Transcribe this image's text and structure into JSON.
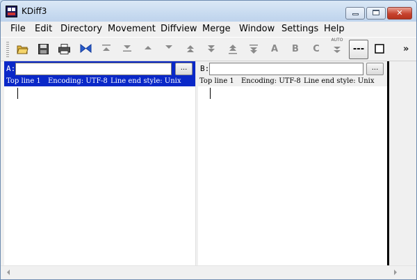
{
  "window": {
    "title": "KDiff3"
  },
  "menu": [
    "File",
    "Edit",
    "Directory",
    "Movement",
    "Diffview",
    "Merge",
    "Window",
    "Settings",
    "Help"
  ],
  "toolbar": {
    "icons": [
      "open-folder-icon",
      "save-icon",
      "print-icon",
      "merge-bowtie-icon",
      "go-top-icon",
      "go-bottom-icon",
      "go-prev-delta-icon",
      "go-next-delta-icon",
      "go-prev-conflict-icon",
      "go-next-conflict-icon",
      "go-prev-unsolved-icon",
      "go-next-unsolved-icon",
      "choose-a-icon",
      "choose-b-icon",
      "choose-c-icon",
      "auto-advance-icon",
      "show-whitespace-icon",
      "show-linenumbers-icon",
      "more-icon"
    ],
    "letter_a": "A",
    "letter_b": "B",
    "letter_c": "C",
    "auto_label": "AUTO",
    "whitespace_label": "---",
    "overflow_label": "»"
  },
  "pane_a": {
    "letter": "A:",
    "path_value": "",
    "browse_label": "...",
    "top_line": "Top line 1",
    "encoding": "Encoding: UTF-8",
    "line_end": "Line end style: Unix"
  },
  "pane_b": {
    "letter": "B:",
    "path_value": "",
    "browse_label": "...",
    "top_line": "Top line 1",
    "encoding": "Encoding: UTF-8",
    "line_end": "Line end style: Unix"
  },
  "colors": {
    "active_pane": "#0a28c8",
    "titlebar": "#c8dbf0",
    "close_button": "#c7432f"
  }
}
